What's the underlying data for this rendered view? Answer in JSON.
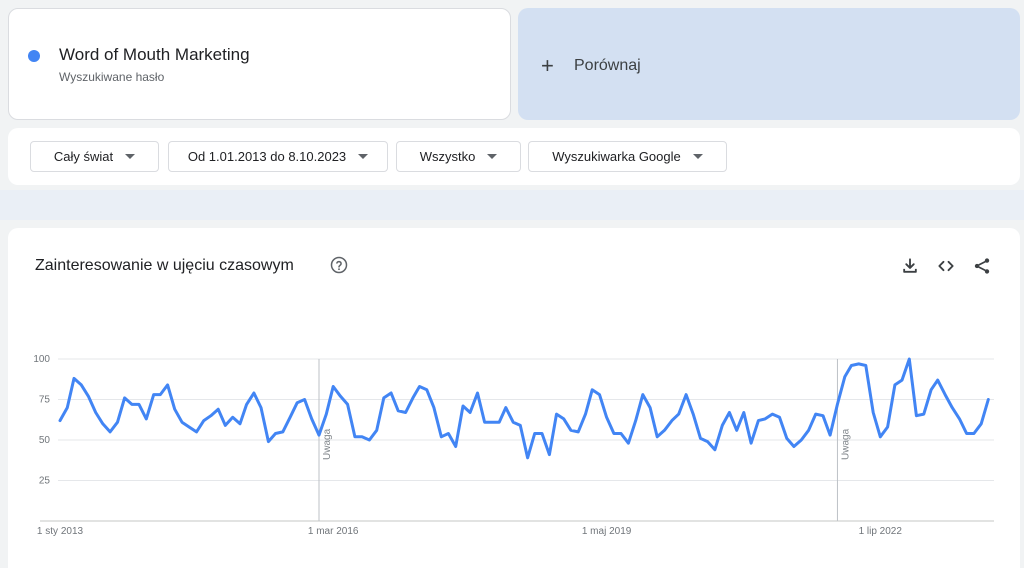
{
  "term": {
    "name": "Word of Mouth Marketing",
    "subtitle": "Wyszukiwane hasło",
    "color": "#4285f4"
  },
  "compare": {
    "plus": "+",
    "label": "Porównaj"
  },
  "filters": [
    {
      "label": "Cały świat"
    },
    {
      "label": "Od 1.01.2013 do 8.10.2023"
    },
    {
      "label": "Wszystko"
    },
    {
      "label": "Wyszukiwarka Google"
    }
  ],
  "chart_header": {
    "title": "Zainteresowanie w ujęciu czasowym",
    "icons": [
      "help-icon",
      "download-icon",
      "embed-icon",
      "share-icon"
    ]
  },
  "chart_data": {
    "type": "line",
    "title": "Zainteresowanie w ujęciu czasowym",
    "xlabel": "",
    "ylabel": "",
    "x_range": [
      "2013-01-01",
      "2023-10-08"
    ],
    "ylim": [
      0,
      100
    ],
    "yticks": [
      25,
      50,
      75,
      100
    ],
    "xticks": [
      {
        "date": "2013-01-01",
        "label": "1 sty 2013"
      },
      {
        "date": "2016-03-01",
        "label": "1 mar 2016"
      },
      {
        "date": "2019-05-01",
        "label": "1 maj 2019"
      },
      {
        "date": "2022-07-01",
        "label": "1 lip 2022"
      }
    ],
    "annotations": [
      {
        "date": "2016-01-01",
        "label": "Uwaga"
      },
      {
        "date": "2022-01-01",
        "label": "Uwaga"
      }
    ],
    "grid": true,
    "legend": "none",
    "series": [
      {
        "color": "#4285f4",
        "points": [
          [
            "2013-01-01",
            62
          ],
          [
            "2013-02-01",
            70
          ],
          [
            "2013-03-01",
            88
          ],
          [
            "2013-04-01",
            84
          ],
          [
            "2013-05-01",
            77
          ],
          [
            "2013-06-01",
            67
          ],
          [
            "2013-07-01",
            60
          ],
          [
            "2013-08-01",
            55
          ],
          [
            "2013-09-01",
            61
          ],
          [
            "2013-10-01",
            76
          ],
          [
            "2013-11-01",
            72
          ],
          [
            "2013-12-01",
            72
          ],
          [
            "2014-01-01",
            63
          ],
          [
            "2014-02-01",
            78
          ],
          [
            "2014-03-01",
            78
          ],
          [
            "2014-04-01",
            84
          ],
          [
            "2014-05-01",
            69
          ],
          [
            "2014-06-01",
            61
          ],
          [
            "2014-07-01",
            58
          ],
          [
            "2014-08-01",
            55
          ],
          [
            "2014-09-01",
            62
          ],
          [
            "2014-10-01",
            65
          ],
          [
            "2014-11-01",
            69
          ],
          [
            "2014-12-01",
            59
          ],
          [
            "2015-01-01",
            64
          ],
          [
            "2015-02-01",
            60
          ],
          [
            "2015-03-01",
            72
          ],
          [
            "2015-04-01",
            79
          ],
          [
            "2015-05-01",
            70
          ],
          [
            "2015-06-01",
            49
          ],
          [
            "2015-07-01",
            54
          ],
          [
            "2015-08-01",
            55
          ],
          [
            "2015-09-01",
            64
          ],
          [
            "2015-10-01",
            73
          ],
          [
            "2015-11-01",
            75
          ],
          [
            "2015-12-01",
            63
          ],
          [
            "2016-01-01",
            53
          ],
          [
            "2016-02-01",
            66
          ],
          [
            "2016-03-01",
            83
          ],
          [
            "2016-04-01",
            77
          ],
          [
            "2016-05-01",
            72
          ],
          [
            "2016-06-01",
            52
          ],
          [
            "2016-07-01",
            52
          ],
          [
            "2016-08-01",
            50
          ],
          [
            "2016-09-01",
            56
          ],
          [
            "2016-10-01",
            76
          ],
          [
            "2016-11-01",
            79
          ],
          [
            "2016-12-01",
            68
          ],
          [
            "2017-01-01",
            67
          ],
          [
            "2017-02-01",
            76
          ],
          [
            "2017-03-01",
            83
          ],
          [
            "2017-04-01",
            81
          ],
          [
            "2017-05-01",
            70
          ],
          [
            "2017-06-01",
            52
          ],
          [
            "2017-07-01",
            54
          ],
          [
            "2017-08-01",
            46
          ],
          [
            "2017-09-01",
            71
          ],
          [
            "2017-10-01",
            67
          ],
          [
            "2017-11-01",
            79
          ],
          [
            "2017-12-01",
            61
          ],
          [
            "2018-01-01",
            61
          ],
          [
            "2018-02-01",
            61
          ],
          [
            "2018-03-01",
            70
          ],
          [
            "2018-04-01",
            61
          ],
          [
            "2018-05-01",
            59
          ],
          [
            "2018-06-01",
            39
          ],
          [
            "2018-07-01",
            54
          ],
          [
            "2018-08-01",
            54
          ],
          [
            "2018-09-01",
            41
          ],
          [
            "2018-10-01",
            66
          ],
          [
            "2018-11-01",
            63
          ],
          [
            "2018-12-01",
            56
          ],
          [
            "2019-01-01",
            55
          ],
          [
            "2019-02-01",
            66
          ],
          [
            "2019-03-01",
            81
          ],
          [
            "2019-04-01",
            78
          ],
          [
            "2019-05-01",
            64
          ],
          [
            "2019-06-01",
            54
          ],
          [
            "2019-07-01",
            54
          ],
          [
            "2019-08-01",
            48
          ],
          [
            "2019-09-01",
            62
          ],
          [
            "2019-10-01",
            78
          ],
          [
            "2019-11-01",
            70
          ],
          [
            "2019-12-01",
            52
          ],
          [
            "2020-01-01",
            56
          ],
          [
            "2020-02-01",
            62
          ],
          [
            "2020-03-01",
            66
          ],
          [
            "2020-04-01",
            78
          ],
          [
            "2020-05-01",
            66
          ],
          [
            "2020-06-01",
            51
          ],
          [
            "2020-07-01",
            49
          ],
          [
            "2020-08-01",
            44
          ],
          [
            "2020-09-01",
            59
          ],
          [
            "2020-10-01",
            67
          ],
          [
            "2020-11-01",
            56
          ],
          [
            "2020-12-01",
            67
          ],
          [
            "2021-01-01",
            48
          ],
          [
            "2021-02-01",
            62
          ],
          [
            "2021-03-01",
            63
          ],
          [
            "2021-04-01",
            66
          ],
          [
            "2021-05-01",
            64
          ],
          [
            "2021-06-01",
            51
          ],
          [
            "2021-07-01",
            46
          ],
          [
            "2021-08-01",
            50
          ],
          [
            "2021-09-01",
            56
          ],
          [
            "2021-10-01",
            66
          ],
          [
            "2021-11-01",
            65
          ],
          [
            "2021-12-01",
            53
          ],
          [
            "2022-01-01",
            72
          ],
          [
            "2022-02-01",
            89
          ],
          [
            "2022-03-01",
            96
          ],
          [
            "2022-04-01",
            97
          ],
          [
            "2022-05-01",
            96
          ],
          [
            "2022-06-01",
            67
          ],
          [
            "2022-07-01",
            52
          ],
          [
            "2022-08-01",
            58
          ],
          [
            "2022-09-01",
            84
          ],
          [
            "2022-10-01",
            87
          ],
          [
            "2022-11-01",
            100
          ],
          [
            "2022-12-01",
            65
          ],
          [
            "2023-01-01",
            66
          ],
          [
            "2023-02-01",
            81
          ],
          [
            "2023-03-01",
            87
          ],
          [
            "2023-04-01",
            78
          ],
          [
            "2023-05-01",
            70
          ],
          [
            "2023-06-01",
            63
          ],
          [
            "2023-07-01",
            54
          ],
          [
            "2023-08-01",
            54
          ],
          [
            "2023-09-01",
            60
          ],
          [
            "2023-10-01",
            75
          ]
        ]
      }
    ]
  }
}
